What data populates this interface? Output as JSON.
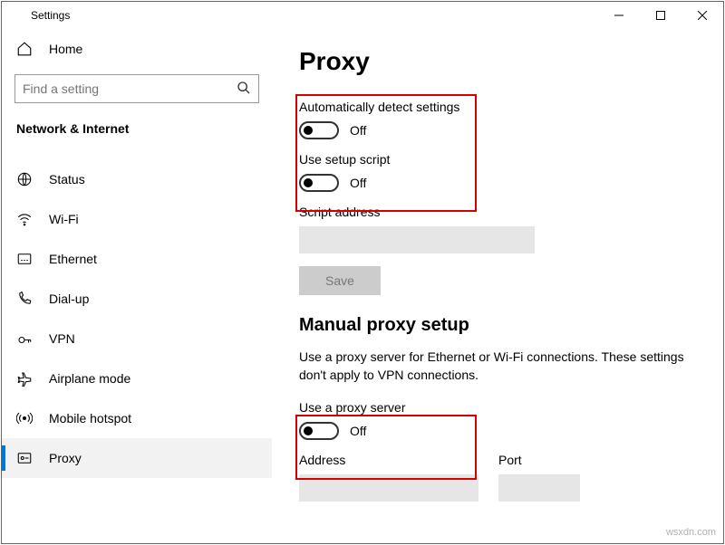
{
  "window": {
    "title": "Settings"
  },
  "sidebar": {
    "home": "Home",
    "search_placeholder": "Find a setting",
    "category": "Network & Internet",
    "items": [
      {
        "label": "Status"
      },
      {
        "label": "Wi-Fi"
      },
      {
        "label": "Ethernet"
      },
      {
        "label": "Dial-up"
      },
      {
        "label": "VPN"
      },
      {
        "label": "Airplane mode"
      },
      {
        "label": "Mobile hotspot"
      },
      {
        "label": "Proxy"
      }
    ]
  },
  "main": {
    "title": "Proxy",
    "auto_detect_label": "Automatically detect settings",
    "auto_detect_state": "Off",
    "setup_script_label": "Use setup script",
    "setup_script_state": "Off",
    "script_address_label": "Script address",
    "save_label": "Save",
    "manual_heading": "Manual proxy setup",
    "manual_desc": "Use a proxy server for Ethernet or Wi-Fi connections. These settings don't apply to VPN connections.",
    "use_proxy_label": "Use a proxy server",
    "use_proxy_state": "Off",
    "address_label": "Address",
    "port_label": "Port"
  },
  "watermark": "wsxdn.com"
}
